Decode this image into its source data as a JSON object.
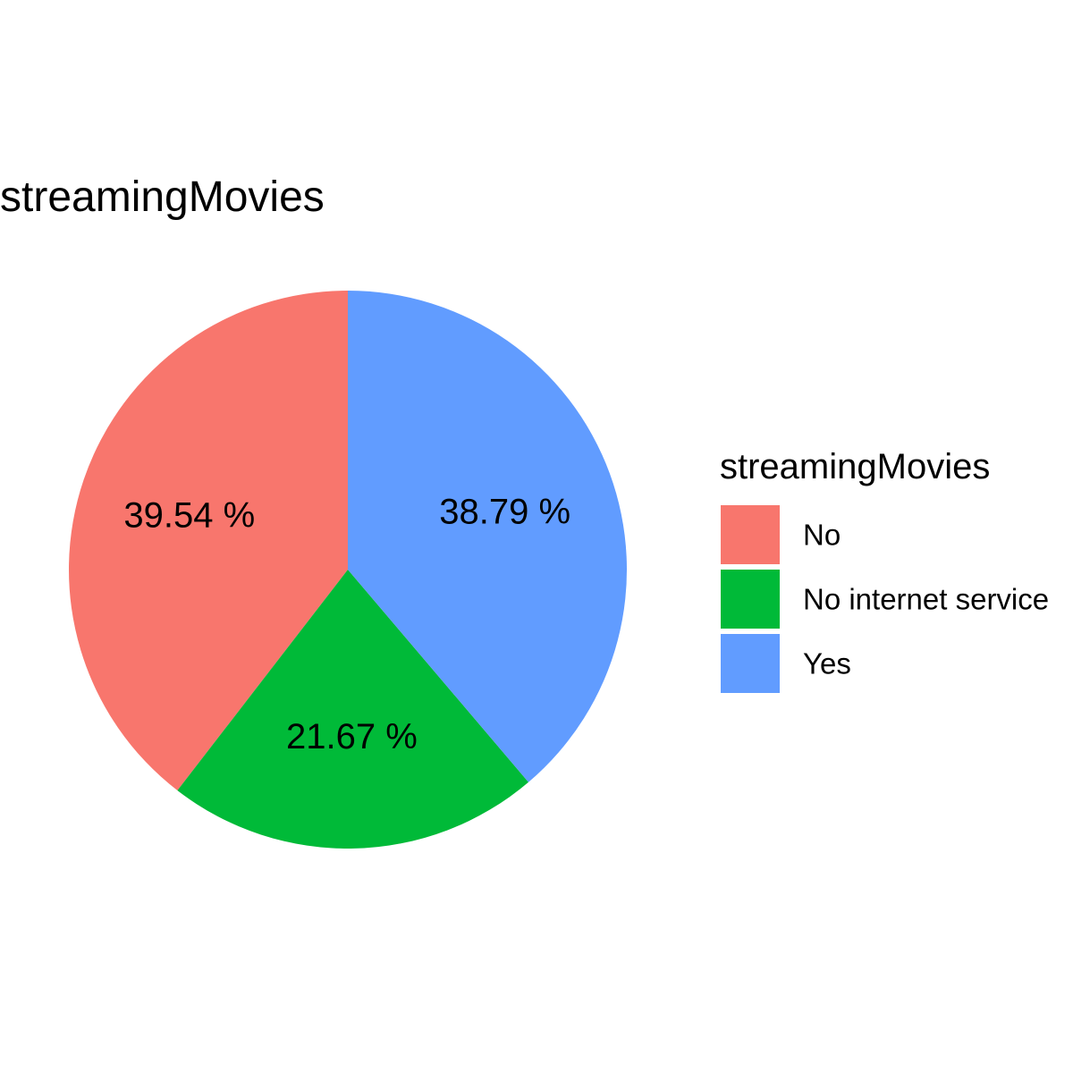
{
  "chart_data": {
    "type": "pie",
    "title": "streamingMovies",
    "legend_title": "streamingMovies",
    "legend_position": "right",
    "categories": [
      "No",
      "No internet service",
      "Yes"
    ],
    "values": [
      39.54,
      21.67,
      38.79
    ],
    "labels": [
      "39.54 %",
      "21.67 %",
      "38.79 %"
    ],
    "colors": [
      "#F8766D",
      "#00BA38",
      "#619CFF"
    ],
    "direction": "counterclockwise",
    "start": "top"
  }
}
